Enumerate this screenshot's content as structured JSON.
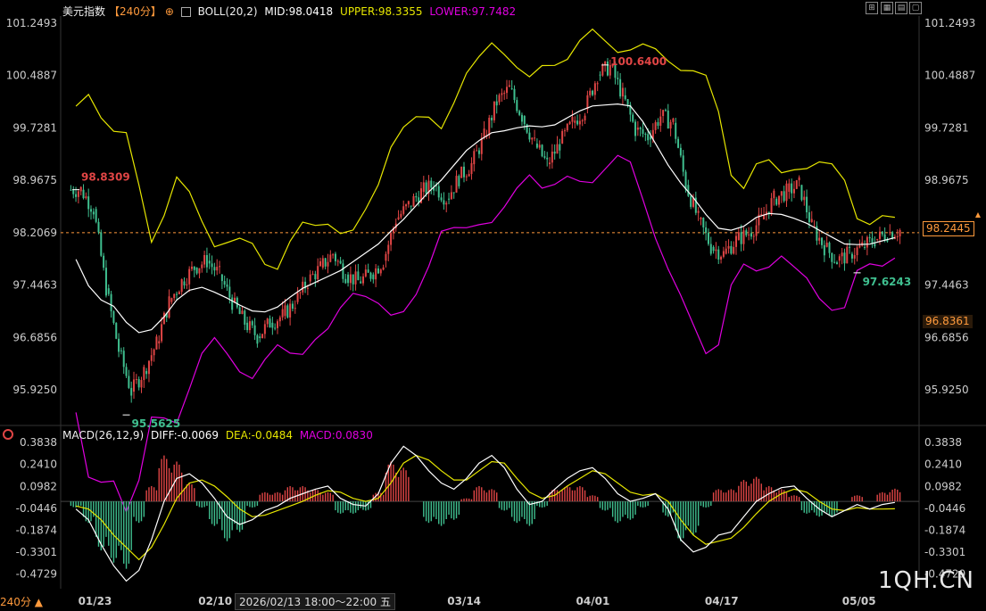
{
  "header": {
    "title": "美元指数",
    "period": "【240分】",
    "period_icon": "⊕",
    "indicator": "BOLL(20,2)",
    "mid": "MID:98.0418",
    "upper": "UPPER:98.3355",
    "lower": "LOWER:97.7482"
  },
  "macd_header": {
    "indicator": "MACD(26,12,9)",
    "diff": "DIFF:-0.0069",
    "dea": "DEA:-0.0484",
    "macd": "MACD:0.0830"
  },
  "price_tags": {
    "current": "98.2445",
    "crosshair": "96.8361",
    "overlap": "98.2069"
  },
  "annotations": {
    "high": "100.6400",
    "low": "95.5625",
    "recent_low": "97.6243",
    "first": "98.8309"
  },
  "footer": {
    "period_badge": "240分 ▲",
    "crosshair_date": "2026/02/13 18:00～22:00 五",
    "watermark": "1QH.CN"
  },
  "colors": {
    "up": "#e04545",
    "down": "#3fbf8f",
    "mid": "#ffffff",
    "upper": "#e6e600",
    "lower": "#e000e0",
    "dea": "#e6e600",
    "diff": "#ffffff",
    "macd_label": "#e000e0",
    "accent": "#ff9a3c"
  },
  "chart_data": [
    {
      "type": "candlestick",
      "title": "美元指数",
      "period": "240分",
      "y_ticks": [
        "101.2493",
        "100.4887",
        "99.7281",
        "98.9675",
        "98.2069",
        "97.4463",
        "96.6856",
        "95.9250"
      ],
      "ylim": [
        95.5,
        101.35
      ],
      "x_ticks": [
        "01/23",
        "02/10",
        "03/14",
        "04/01",
        "04/17",
        "05/05"
      ],
      "annotations": {
        "high": 100.64,
        "low": 95.5625,
        "recent_low": 97.6243,
        "first": 98.8309
      },
      "boll_last": {
        "mid": 98.0418,
        "upper": 98.3355,
        "lower": 97.7482
      },
      "current_price": 98.2445,
      "close_series": [
        98.83,
        98.55,
        97.4,
        96.5,
        95.9,
        96.2,
        96.6,
        97.2,
        97.5,
        97.7,
        97.8,
        97.6,
        97.2,
        96.9,
        96.7,
        96.9,
        97.0,
        97.2,
        97.5,
        97.7,
        97.9,
        97.6,
        97.5,
        97.6,
        97.8,
        98.4,
        98.6,
        98.8,
        98.9,
        98.7,
        99.0,
        99.2,
        99.6,
        100.1,
        100.3,
        99.9,
        99.5,
        99.2,
        99.5,
        99.8,
        100.0,
        100.5,
        100.62,
        100.2,
        99.7,
        99.6,
        99.9,
        99.8,
        98.9,
        98.4,
        98.0,
        97.9,
        98.1,
        98.2,
        98.4,
        98.7,
        98.8,
        98.9,
        98.3,
        98.0,
        97.8,
        97.9,
        98.0,
        98.1,
        98.2,
        98.24
      ],
      "macd": {
        "y_ticks": [
          "0.3838",
          "0.2410",
          "0.0982",
          "-0.0446",
          "-0.1874",
          "-0.3301",
          "-0.4729"
        ],
        "ylim": [
          -0.57,
          0.42
        ],
        "diff": [
          -0.05,
          -0.12,
          -0.28,
          -0.42,
          -0.52,
          -0.45,
          -0.25,
          0.0,
          0.15,
          0.18,
          0.12,
          0.02,
          -0.1,
          -0.15,
          -0.12,
          -0.06,
          -0.03,
          0.02,
          0.05,
          0.08,
          0.1,
          0.02,
          -0.02,
          -0.03,
          0.05,
          0.25,
          0.36,
          0.3,
          0.2,
          0.12,
          0.08,
          0.15,
          0.25,
          0.3,
          0.22,
          0.08,
          -0.02,
          0.0,
          0.08,
          0.15,
          0.2,
          0.22,
          0.15,
          0.05,
          0.0,
          0.02,
          0.05,
          -0.05,
          -0.25,
          -0.33,
          -0.3,
          -0.22,
          -0.2,
          -0.1,
          0.0,
          0.05,
          0.09,
          0.1,
          0.02,
          -0.05,
          -0.1,
          -0.06,
          -0.02,
          -0.05,
          -0.02,
          -0.0069
        ],
        "dea": [
          -0.03,
          -0.05,
          -0.12,
          -0.22,
          -0.3,
          -0.38,
          -0.3,
          -0.15,
          0.02,
          0.12,
          0.14,
          0.1,
          0.03,
          -0.05,
          -0.1,
          -0.09,
          -0.06,
          -0.03,
          0.0,
          0.04,
          0.07,
          0.06,
          0.02,
          0.0,
          0.02,
          0.12,
          0.25,
          0.3,
          0.27,
          0.2,
          0.14,
          0.14,
          0.2,
          0.26,
          0.25,
          0.15,
          0.06,
          0.02,
          0.04,
          0.1,
          0.15,
          0.2,
          0.18,
          0.12,
          0.06,
          0.04,
          0.05,
          0.0,
          -0.12,
          -0.22,
          -0.28,
          -0.26,
          -0.24,
          -0.17,
          -0.08,
          0.0,
          0.05,
          0.08,
          0.06,
          0.0,
          -0.05,
          -0.06,
          -0.04,
          -0.05,
          -0.05,
          -0.0484
        ],
        "hist": [
          -0.04,
          -0.14,
          -0.32,
          -0.4,
          -0.44,
          -0.14,
          0.1,
          0.3,
          0.26,
          0.12,
          -0.04,
          -0.16,
          -0.26,
          -0.2,
          -0.04,
          0.06,
          0.06,
          0.1,
          0.1,
          0.08,
          0.06,
          -0.08,
          -0.08,
          -0.06,
          0.06,
          0.26,
          0.22,
          0.0,
          -0.14,
          -0.16,
          -0.12,
          0.02,
          0.1,
          0.08,
          -0.06,
          -0.14,
          -0.16,
          -0.04,
          0.08,
          0.1,
          0.1,
          0.04,
          -0.06,
          -0.14,
          -0.12,
          -0.04,
          0.0,
          -0.1,
          -0.26,
          -0.22,
          -0.04,
          0.08,
          0.08,
          0.14,
          0.16,
          0.1,
          0.08,
          0.04,
          -0.08,
          -0.1,
          -0.1,
          0.0,
          0.04,
          0.0,
          0.06,
          0.083
        ]
      }
    }
  ]
}
